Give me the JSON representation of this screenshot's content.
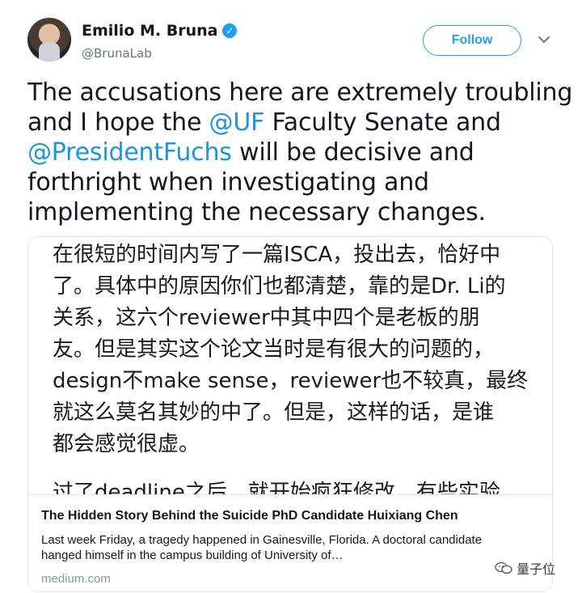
{
  "tweet": {
    "author_name": "Emilio M. Bruna",
    "handle": "@BrunaLab",
    "follow_label": "Follow",
    "verified_glyph": "✓",
    "text_lines": [
      [
        "The accusations here are extremely troubling"
      ],
      [
        "and I hope  the ",
        "@UF",
        " Faculty Senate and"
      ],
      [
        "@PresidentFuchs",
        " will be decisive and"
      ],
      [
        "forthright when investigating and"
      ],
      [
        "implementing the necessary changes."
      ]
    ]
  },
  "card": {
    "image_lines": [
      "在很短的时间内写了一篇ISCA，投出去，恰好中",
      "了。具体中的原因你们也都清楚，靠的是Dr. Li的",
      "关系，这六个reviewer中其中四个是老板的朋",
      "友。但是其实这个论文当时是有很大的问题的，",
      "design不make sense，reviewer也不较真，最终",
      "就这么莫名其妙的中了。但是，这样的话，是谁",
      "都会感觉很虚。",
      "",
      "过了deadline之后，就开始疯狂修改，有些实验"
    ],
    "title": "The Hidden Story Behind the Suicide PhD Candidate Huixiang Chen",
    "description_line1": "Last week Friday, a tragedy happened in Gainesville, Florida. A doctoral candidate",
    "description_line2": "hanged himself in the campus building of University of…",
    "domain": "medium.com"
  },
  "watermark": {
    "text": "量子位"
  },
  "icons": {
    "avatar": "profile-photo",
    "verified": "verified-badge-icon",
    "caret": "chevron-down-icon",
    "watermark": "wechat-logo-icon"
  },
  "colors": {
    "accent": "#1da1f2",
    "mention": "#1b95e0",
    "muted": "#657786"
  }
}
